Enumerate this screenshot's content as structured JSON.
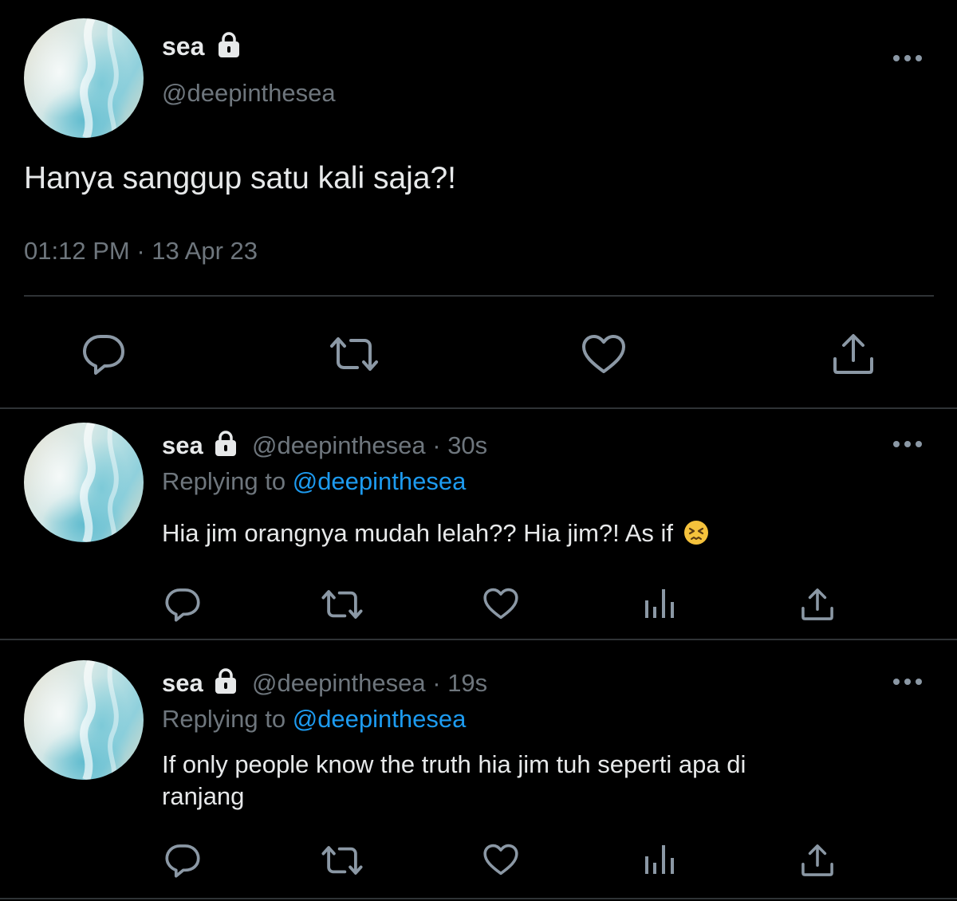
{
  "main_tweet": {
    "display_name": "sea",
    "handle": "@deepinthesea",
    "text": "Hanya sanggup satu kali saja?!",
    "time": "01:12 PM",
    "date": "13 Apr 23",
    "separator": " · "
  },
  "replies": [
    {
      "display_name": "sea",
      "handle": "@deepinthesea",
      "age": "30s",
      "separator": " · ",
      "replying_label": "Replying to",
      "replying_to": "@deepinthesea",
      "text": "Hia jim orangnya mudah lelah?? Hia jim?! As if",
      "emoji": "persevering-face"
    },
    {
      "display_name": "sea",
      "handle": "@deepinthesea",
      "age": "19s",
      "separator": " · ",
      "replying_label": "Replying to",
      "replying_to": "@deepinthesea",
      "text_line1": "If only people know the truth hia jim tuh seperti apa di",
      "text_line2": "ranjang"
    }
  ],
  "icons": {
    "reply": "reply-icon",
    "retweet": "retweet-icon",
    "like": "heart-icon",
    "analytics": "analytics-icon",
    "share": "share-icon",
    "more": "more-icon",
    "lock": "lock-icon"
  },
  "colors": {
    "background": "#000000",
    "text": "#e7e9ea",
    "muted": "#6e767d",
    "link": "#1d9bf0",
    "divider": "#2f3336",
    "icon": "#8b98a5"
  }
}
